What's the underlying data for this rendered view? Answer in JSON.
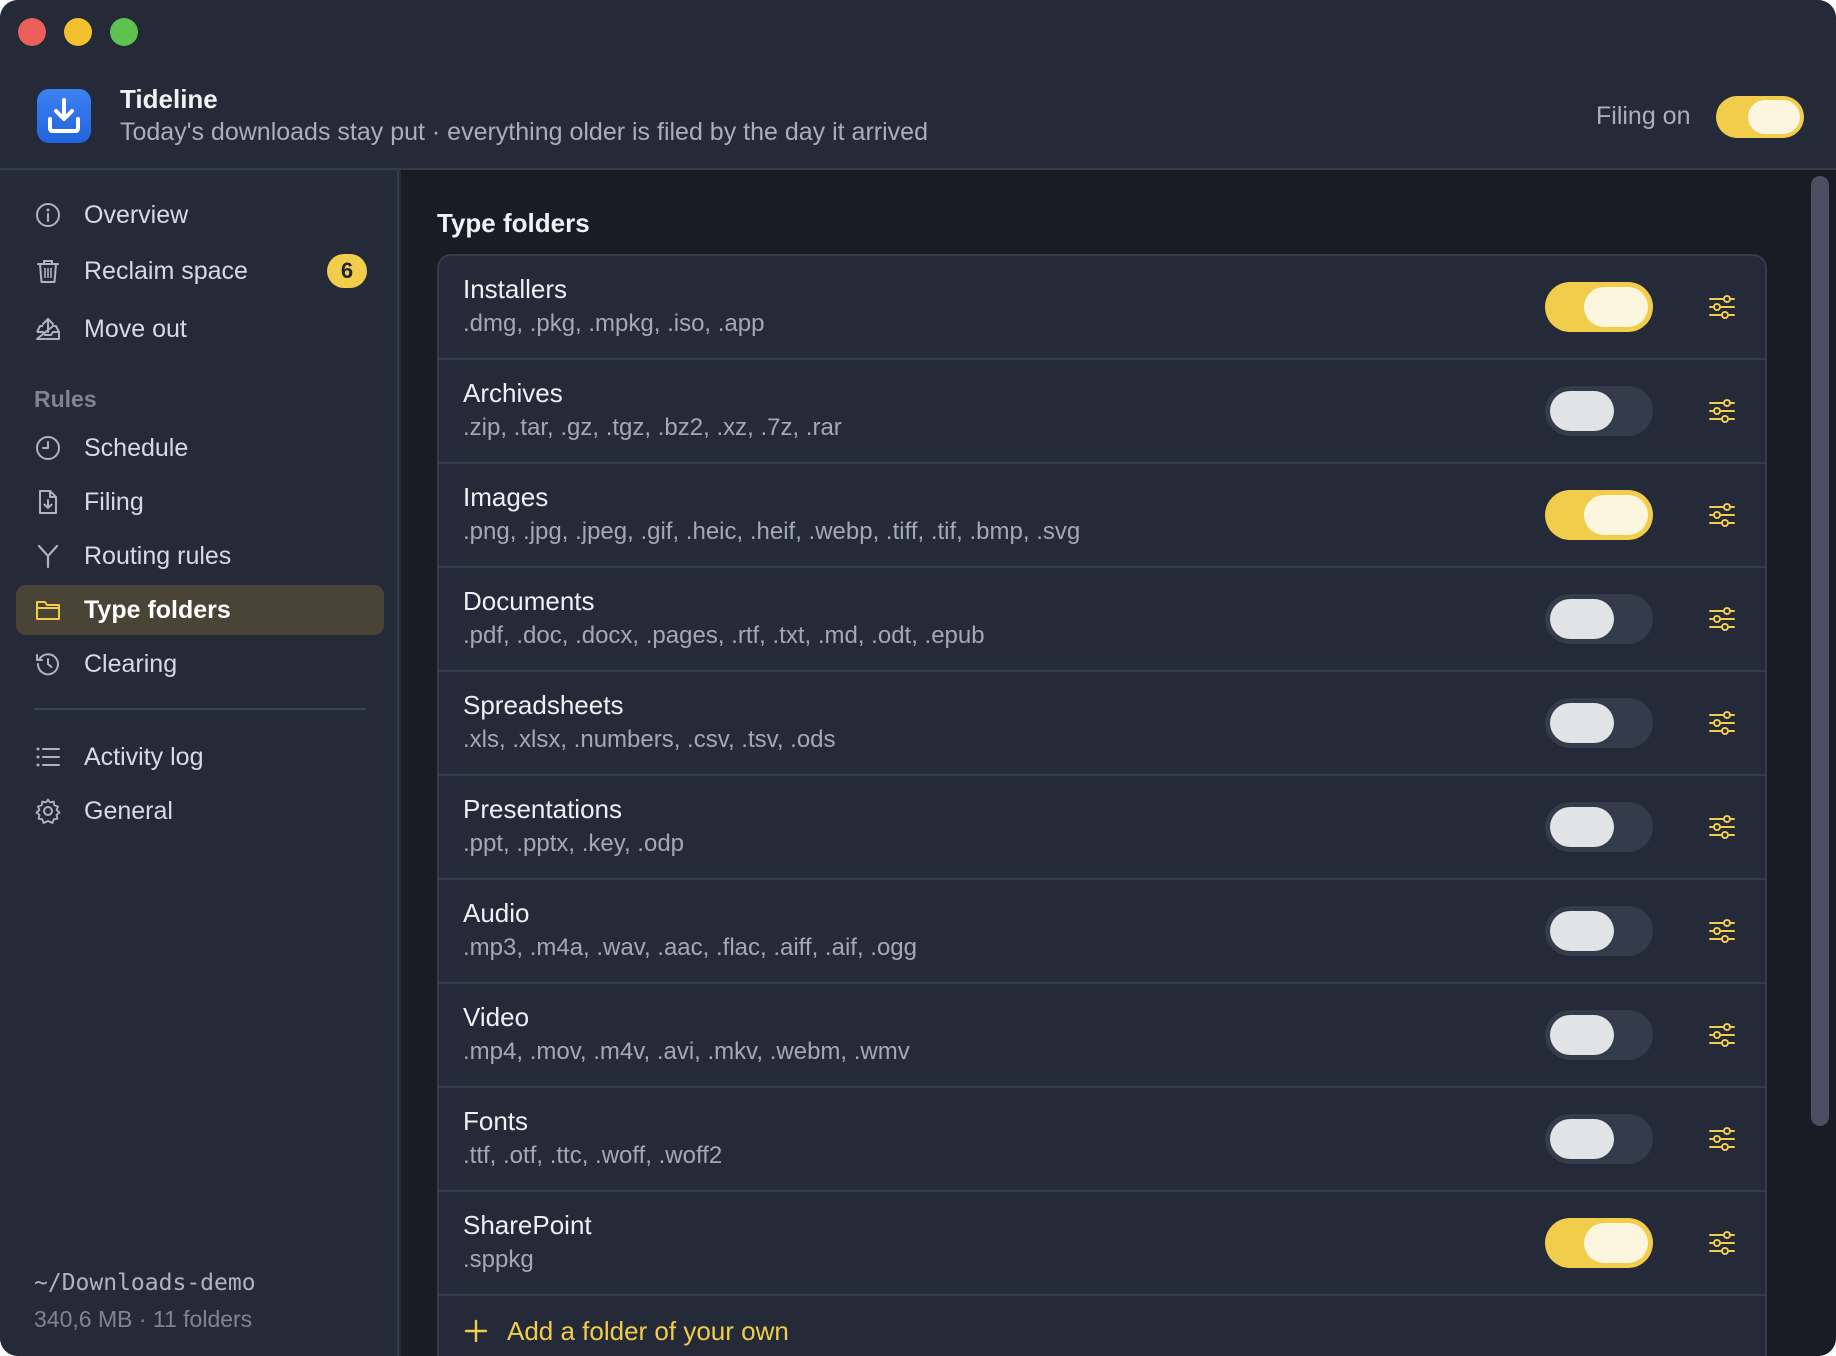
{
  "window": {
    "controls": [
      "close",
      "minimize",
      "zoom"
    ]
  },
  "header": {
    "app_name": "Tideline",
    "subtitle": "Today's downloads stay put · everything older is filed by the day it arrived",
    "filing_label": "Filing on",
    "filing_enabled": true,
    "app_icon": "download-tray-icon"
  },
  "sidebar": {
    "top_items": [
      {
        "label": "Overview",
        "icon": "info-circle-icon"
      },
      {
        "label": "Reclaim space",
        "icon": "trash-icon",
        "badge": "6"
      },
      {
        "label": "Move out",
        "icon": "tray-upload-icon"
      }
    ],
    "rules_heading": "Rules",
    "rule_items": [
      {
        "label": "Schedule",
        "icon": "clock-icon"
      },
      {
        "label": "Filing",
        "icon": "document-download-icon"
      },
      {
        "label": "Routing rules",
        "icon": "fork-icon"
      },
      {
        "label": "Type folders",
        "icon": "folder-icon",
        "active": true
      },
      {
        "label": "Clearing",
        "icon": "history-icon"
      }
    ],
    "bottom_items": [
      {
        "label": "Activity log",
        "icon": "list-icon"
      },
      {
        "label": "General",
        "icon": "gear-icon"
      }
    ],
    "footer": {
      "path": "~/Downloads-demo",
      "stats": "340,6 MB · 11 folders"
    }
  },
  "main": {
    "title": "Type folders",
    "folders": [
      {
        "name": "Installers",
        "extensions": ".dmg, .pkg, .mpkg, .iso, .app",
        "enabled": true
      },
      {
        "name": "Archives",
        "extensions": ".zip, .tar, .gz, .tgz, .bz2, .xz, .7z, .rar",
        "enabled": false
      },
      {
        "name": "Images",
        "extensions": ".png, .jpg, .jpeg, .gif, .heic, .heif, .webp, .tiff, .tif, .bmp, .svg",
        "enabled": true
      },
      {
        "name": "Documents",
        "extensions": ".pdf, .doc, .docx, .pages, .rtf, .txt, .md, .odt, .epub",
        "enabled": false
      },
      {
        "name": "Spreadsheets",
        "extensions": ".xls, .xlsx, .numbers, .csv, .tsv, .ods",
        "enabled": false
      },
      {
        "name": "Presentations",
        "extensions": ".ppt, .pptx, .key, .odp",
        "enabled": false
      },
      {
        "name": "Audio",
        "extensions": ".mp3, .m4a, .wav, .aac, .flac, .aiff, .aif, .ogg",
        "enabled": false
      },
      {
        "name": "Video",
        "extensions": ".mp4, .mov, .m4v, .avi, .mkv, .webm, .wmv",
        "enabled": false
      },
      {
        "name": "Fonts",
        "extensions": ".ttf, .otf, .ttc, .woff, .woff2",
        "enabled": false
      },
      {
        "name": "SharePoint",
        "extensions": ".sppkg",
        "enabled": true
      }
    ],
    "add_label": "Add a folder of your own"
  },
  "colors": {
    "accent": "#f2cc4b",
    "window_bg": "#242a38",
    "content_bg": "#181c25",
    "active_nav_bg": "#4a4436"
  }
}
